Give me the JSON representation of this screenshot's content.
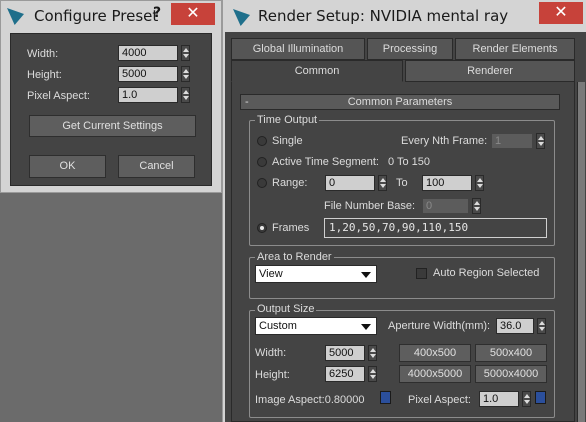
{
  "configure_preset": {
    "title": "Configure Preset",
    "help": "?",
    "close": "✕",
    "width_label": "Width:",
    "width_value": "4000",
    "height_label": "Height:",
    "height_value": "5000",
    "pixel_aspect_label": "Pixel Aspect:",
    "pixel_aspect_value": "1.0",
    "get_current": "Get Current Settings",
    "ok": "OK",
    "cancel": "Cancel"
  },
  "render_setup": {
    "title": "Render Setup: NVIDIA mental ray",
    "close": "✕",
    "tabs_top": [
      "Global Illumination",
      "Processing",
      "Render Elements"
    ],
    "tabs_bottom": [
      "Common",
      "Renderer"
    ],
    "rollout": {
      "toggle": "-",
      "title": "Common Parameters"
    },
    "time_output": {
      "title": "Time Output",
      "single": "Single",
      "every_nth_label": "Every Nth Frame:",
      "every_nth_value": "1",
      "active_segment": "Active Time Segment:",
      "active_segment_value": "0 To 150",
      "range": "Range:",
      "range_from": "0",
      "to": "To",
      "range_to": "100",
      "file_number_base_label": "File Number Base:",
      "file_number_base_value": "0",
      "frames": "Frames",
      "frames_value": "1,20,50,70,90,110,150"
    },
    "area_to_render": {
      "title": "Area to Render",
      "selected": "View",
      "auto_region": "Auto Region Selected"
    },
    "output_size": {
      "title": "Output Size",
      "selected": "Custom",
      "aperture_label": "Aperture Width(mm):",
      "aperture_value": "36.0",
      "width_label": "Width:",
      "width_value": "5000",
      "height_label": "Height:",
      "height_value": "6250",
      "presets": [
        "400x500",
        "500x400",
        "4000x5000",
        "5000x4000"
      ],
      "image_aspect": "Image Aspect:0.80000",
      "pixel_aspect_label": "Pixel Aspect:",
      "pixel_aspect_value": "1.0"
    }
  },
  "colors": {
    "title_bar": "#d4d4d4",
    "panel": "#444444",
    "close_red": "#c7423a",
    "field": "#cfcfcf"
  }
}
